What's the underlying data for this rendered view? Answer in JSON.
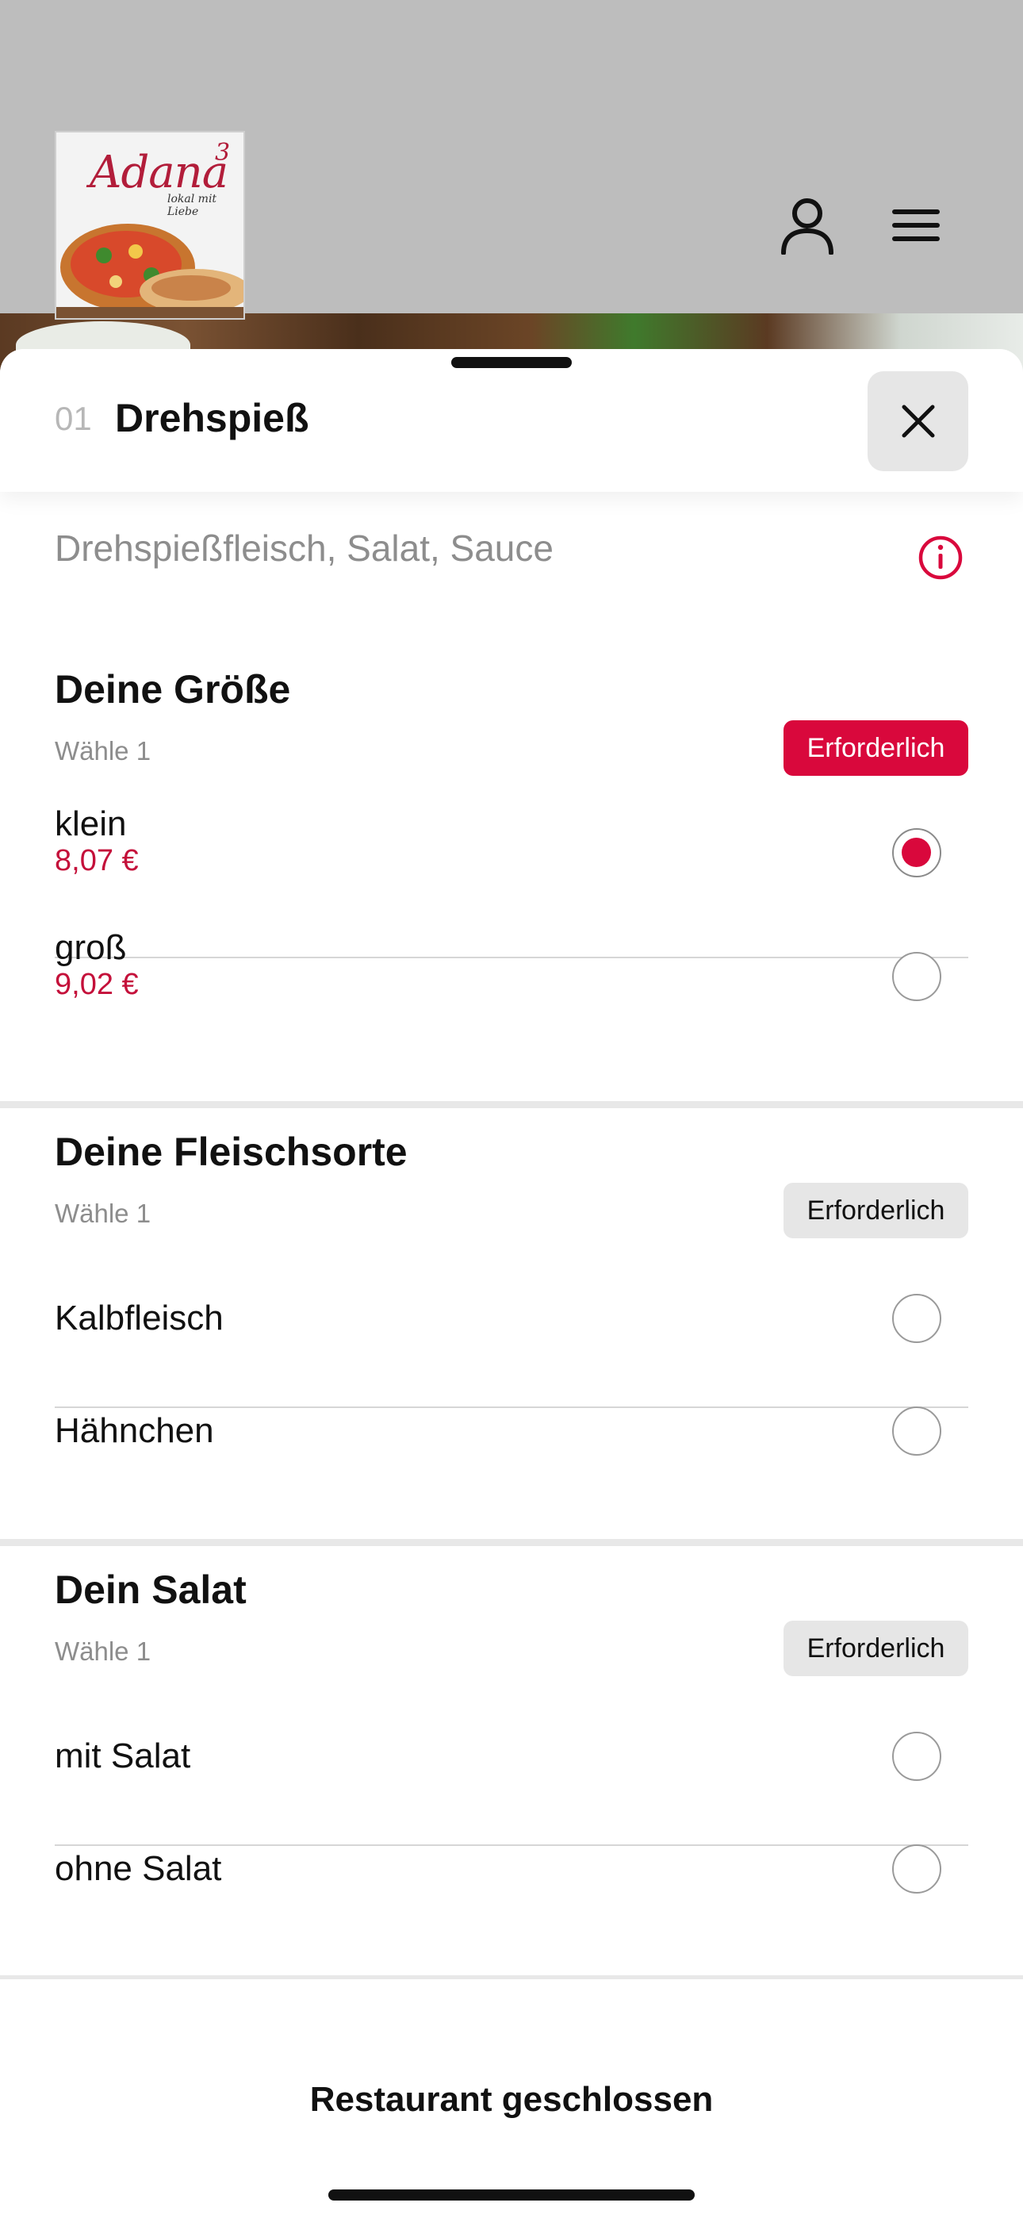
{
  "brand": {
    "name": "Adana",
    "superscript": "3",
    "tagline": "lokal mit Liebe"
  },
  "header": {
    "user_icon": "user-icon",
    "menu_icon": "hamburger-menu-icon"
  },
  "item": {
    "number": "01",
    "title": "Drehspieß",
    "description": "Drehspießfleisch, Salat, Sauce",
    "close_icon": "close-icon",
    "info_icon": "info-icon"
  },
  "sections": [
    {
      "title": "Deine Größe",
      "subtitle": "Wähle 1",
      "badge": "Erforderlich",
      "badge_active": true,
      "options": [
        {
          "label": "klein",
          "price": "8,07 €",
          "selected": true
        },
        {
          "label": "groß",
          "price": "9,02 €",
          "selected": false
        }
      ]
    },
    {
      "title": "Deine Fleischsorte",
      "subtitle": "Wähle 1",
      "badge": "Erforderlich",
      "badge_active": false,
      "options": [
        {
          "label": "Kalbfleisch",
          "selected": false
        },
        {
          "label": "Hähnchen",
          "selected": false
        }
      ]
    },
    {
      "title": "Dein Salat",
      "subtitle": "Wähle 1",
      "badge": "Erforderlich",
      "badge_active": false,
      "options": [
        {
          "label": "mit Salat",
          "selected": false
        },
        {
          "label": "ohne Salat",
          "selected": false
        }
      ]
    }
  ],
  "footer": {
    "status": "Restaurant geschlossen"
  },
  "colors": {
    "accent": "#d9083c",
    "price": "#c4103a",
    "header_bg": "#bdbdbd"
  }
}
